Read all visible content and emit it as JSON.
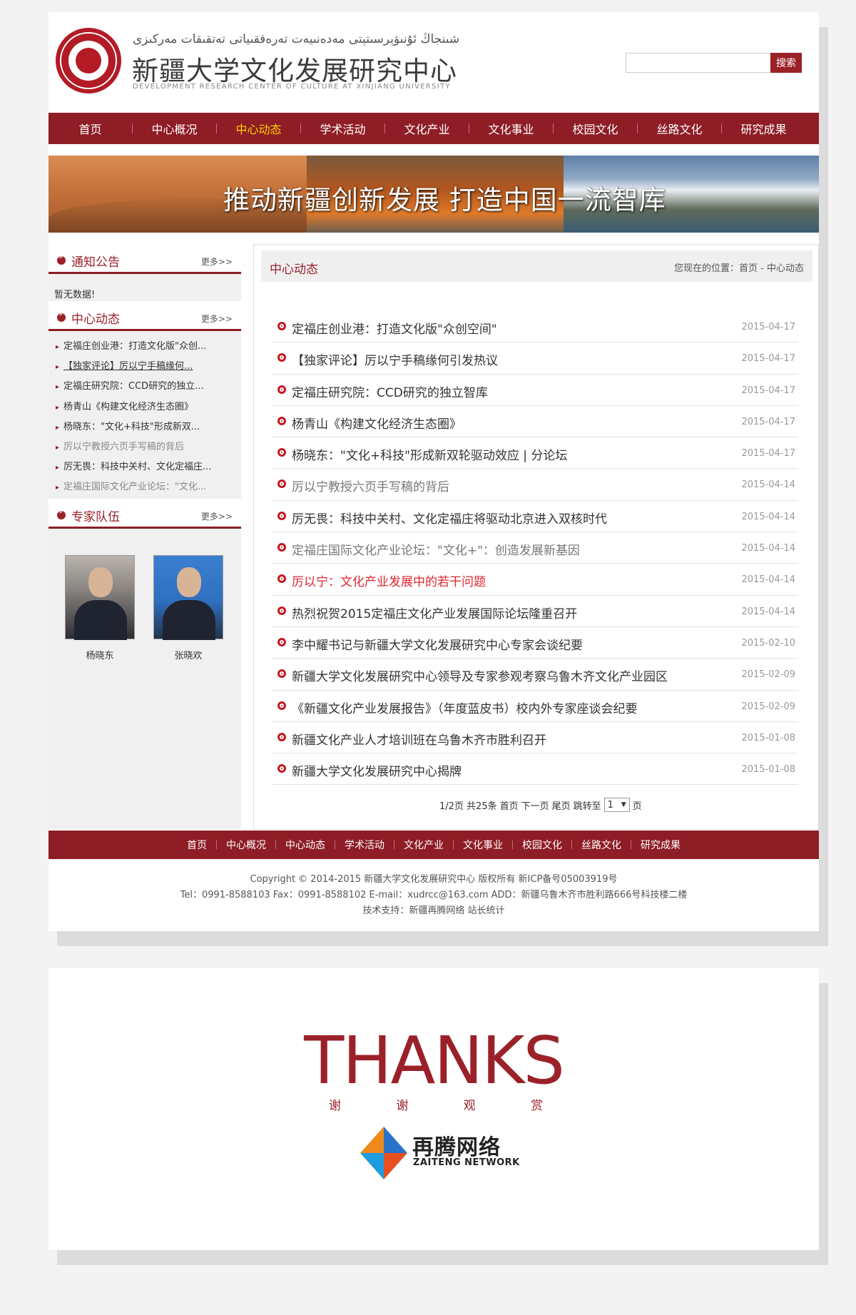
{
  "header": {
    "uyghur_name": "شىنجاڭ ئۇنىۋېرسىتېتى مەدەنىيەت تەرەققىياتى تەتقىقات مەركىزى",
    "title": "新疆大学文化发展研究中心",
    "subtitle_en": "DEVELOPMENT RESEARCH CENTER OF CULTURE AT XINJIANG UNIVERSITY",
    "search_placeholder": "",
    "search_button": "搜索",
    "logo_icon": "xinjiang-university-seal-icon"
  },
  "nav": {
    "items": [
      "首页",
      "中心概况",
      "中心动态",
      "学术活动",
      "文化产业",
      "文化事业",
      "校园文化",
      "丝路文化",
      "研究成果"
    ],
    "active_index": 2
  },
  "banner": {
    "text": "推动新疆创新发展 打造中国一流智库"
  },
  "sidebar": {
    "notice": {
      "title": "通知公告",
      "more": "更多>>",
      "empty": "暂无数据!"
    },
    "news": {
      "title": "中心动态",
      "more": "更多>>",
      "items": [
        "定福庄创业港：打造文化版\"众创...",
        "【独家评论】厉以宁手稿缘何...",
        "定福庄研究院：CCD研究的独立...",
        "杨青山《构建文化经济生态圈》",
        "杨晓东：\"文化+科技\"形成新双...",
        "厉以宁教授六页手写稿的背后",
        "厉无畏：科技中关村、文化定福庄...",
        "定福庄国际文化产业论坛：\"文化..."
      ]
    },
    "experts": {
      "title": "专家队伍",
      "more": "更多>>",
      "people": [
        {
          "name": "杨晓东"
        },
        {
          "name": "张晓欢"
        }
      ]
    }
  },
  "main": {
    "title": "中心动态",
    "breadcrumb": "您现在的位置：首页 - 中心动态",
    "articles": [
      {
        "title": "定福庄创业港：打造文化版\"众创空间\"",
        "date": "2015-04-17"
      },
      {
        "title": "【独家评论】厉以宁手稿缘何引发热议",
        "date": "2015-04-17"
      },
      {
        "title": "定福庄研究院：CCD研究的独立智库",
        "date": "2015-04-17"
      },
      {
        "title": "杨青山《构建文化经济生态圈》",
        "date": "2015-04-17"
      },
      {
        "title": "杨晓东：\"文化+科技\"形成新双轮驱动效应 | 分论坛",
        "date": "2015-04-17"
      },
      {
        "title": "厉以宁教授六页手写稿的背后",
        "date": "2015-04-14"
      },
      {
        "title": "厉无畏：科技中关村、文化定福庄将驱动北京进入双核时代",
        "date": "2015-04-14"
      },
      {
        "title": "定福庄国际文化产业论坛：\"文化+\"：创造发展新基因",
        "date": "2015-04-14"
      },
      {
        "title": "厉以宁：文化产业发展中的若干问题",
        "date": "2015-04-14"
      },
      {
        "title": "热烈祝贺2015定福庄文化产业发展国际论坛隆重召开",
        "date": "2015-04-14"
      },
      {
        "title": "李中耀书记与新疆大学文化发展研究中心专家会谈纪要",
        "date": "2015-02-10"
      },
      {
        "title": "新疆大学文化发展研究中心领导及专家参观考察乌鲁木齐文化产业园区",
        "date": "2015-02-09"
      },
      {
        "title": "《新疆文化产业发展报告》（年度蓝皮书）校内外专家座谈会纪要",
        "date": "2015-02-09"
      },
      {
        "title": "新疆文化产业人才培训班在乌鲁木齐市胜利召开",
        "date": "2015-01-08"
      },
      {
        "title": "新疆大学文化发展研究中心揭牌",
        "date": "2015-01-08"
      }
    ],
    "pager": {
      "info": "1/2页 共25条",
      "first": "首页",
      "next": "下一页",
      "last": "尾页",
      "jump": "跳转至",
      "page_value": "1",
      "page_unit": "页"
    }
  },
  "footer": {
    "nav": [
      "首页",
      "中心概况",
      "中心动态",
      "学术活动",
      "文化产业",
      "文化事业",
      "校园文化",
      "丝路文化",
      "研究成果"
    ],
    "copyright": "Copyright © 2014-2015 新疆大学文化发展研究中心 版权所有 新ICP备号05003919号",
    "contact": "Tel：0991-8588103 Fax：0991-8588102 E-mail：xudrcc@163.com ADD：新疆乌鲁木齐市胜利路666号科技楼二楼",
    "support": "技术支持：新疆再腾网络 站长统计"
  },
  "thanks": {
    "title": "THANKS",
    "subtitle": [
      "谢",
      "谢",
      "观",
      "赏"
    ],
    "brand_cn": "再腾网络",
    "brand_en": "ZAITENG NETWORK"
  },
  "colors": {
    "brand_red": "#8e1d26",
    "accent_red": "#9b2129",
    "nav_active": "#ffd200",
    "highlight_link": "#e0262f"
  }
}
